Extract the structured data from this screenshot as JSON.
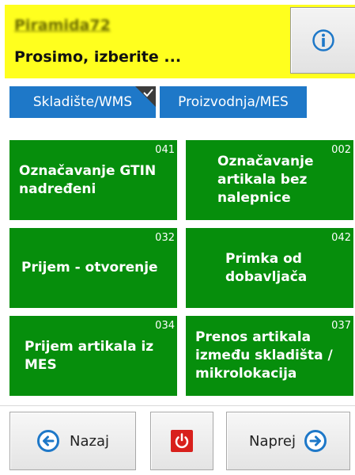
{
  "header": {
    "app_name": "Piramida72",
    "prompt": "Prosimo, izberite ...",
    "info_icon": "info-icon",
    "background": "#ffff1e"
  },
  "tabs": [
    {
      "label": "Skladište/WMS",
      "selected": true
    },
    {
      "label": "Proizvodnja/MES",
      "selected": false
    }
  ],
  "tiles": [
    {
      "code": "041",
      "label": "Označavanje GTIN\nnadređeni"
    },
    {
      "code": "002",
      "label": "Označavanje\nartikala bez\nnalepnice"
    },
    {
      "code": "032",
      "label": "Prijem - otvorenje"
    },
    {
      "code": "042",
      "label": "Primka od\ndobavljača"
    },
    {
      "code": "034",
      "label": "Prijem artikala iz\nMES"
    },
    {
      "code": "037",
      "label": "Prenos artikala\nizmeđu skladišta /\nmikrolokacija"
    }
  ],
  "footer": {
    "back_label": "Nazaj",
    "next_label": "Naprej",
    "power_icon": "power-icon"
  },
  "colors": {
    "tile_green": "#068e0c",
    "tab_blue": "#1e78c8",
    "power_red": "#d8201c"
  }
}
